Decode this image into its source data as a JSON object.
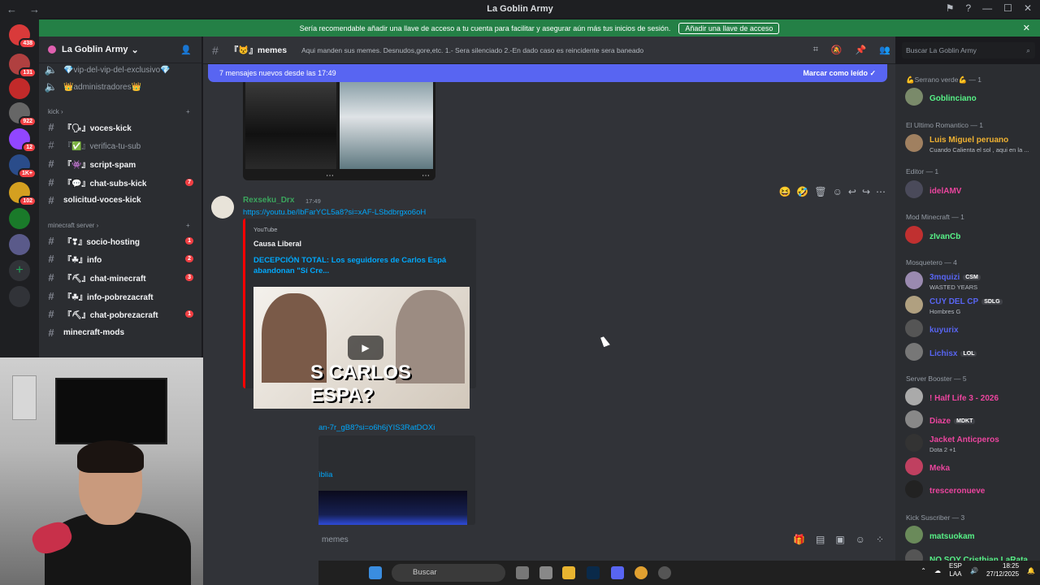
{
  "window": {
    "title": "La Goblin Army"
  },
  "banner": {
    "text": "Sería recomendable añadir una llave de acceso a tu cuenta para facilitar y asegurar aún más tus inicios de sesión.",
    "button": "Añadir una llave de acceso"
  },
  "servers": [
    {
      "badge": "438",
      "color": "#d93a3a"
    },
    {
      "badge": "131",
      "color": "#b04040"
    },
    {
      "badge": "",
      "color": "#c22a2a"
    },
    {
      "badge": "922",
      "color": "#666666"
    },
    {
      "badge": "12",
      "color": "#9146ff"
    },
    {
      "badge": "1K+",
      "color": "#2a4c8a"
    },
    {
      "badge": "102",
      "color": "#d4a020"
    },
    {
      "badge": "",
      "color": "#1a7a2a"
    },
    {
      "badge": "",
      "color": "#5a5a8a"
    }
  ],
  "guild": {
    "name": "La Goblin Army"
  },
  "channels_top": [
    {
      "label": "💎vip-del-vip-del-exclusivo💎"
    },
    {
      "label": "👑administradores👑"
    }
  ],
  "categories": {
    "kick": "kick",
    "minecraft": "minecraft server"
  },
  "channels_kick": [
    {
      "label": "『🗣』voces-kick",
      "badge": ""
    },
    {
      "label": "『✅』verifica-tu-sub",
      "badge": ""
    },
    {
      "label": "『👾』script-spam",
      "badge": ""
    },
    {
      "label": "『💬』chat-subs-kick",
      "badge": "7"
    },
    {
      "label": "solicitud-voces-kick",
      "badge": ""
    }
  ],
  "channels_mc": [
    {
      "label": "『❣』socio-hosting",
      "badge": "1"
    },
    {
      "label": "『☘』info",
      "badge": "2"
    },
    {
      "label": "『⛏』chat-minecraft",
      "badge": "3"
    },
    {
      "label": "『☘』info-pobrezacraft",
      "badge": ""
    },
    {
      "label": "『⛏』chat-pobrezacraft",
      "badge": "1"
    },
    {
      "label": "minecraft-mods",
      "badge": ""
    }
  ],
  "chat": {
    "channel": "『😾』memes",
    "topic": "Aqui manden sus memes. Desnudos,gore,etc. 1.- Sera silenciado 2.-En dado caso es reincidente sera baneado",
    "new_messages": "7 mensajes nuevos desde las 17:49",
    "mark_read": "Marcar como leído",
    "message": {
      "author": "Rexseku_Drx",
      "time": "17:49",
      "link": "https://youtu.be/IbFarYCL5a8?si=xAF-LSbdbrgxo6oH",
      "embed_provider": "YouTube",
      "embed_author": "Causa Liberal",
      "embed_title": "DECEPCIÓN TOTAL: Los seguidores de Carlos Espá abandonan \"Sí Cre...",
      "thumb_text": "S CARLOS ESPA?"
    },
    "message2_link": "an-7r_gB8?si=o6h6jYIS3RatDOXi",
    "message2_embed": "ìblia",
    "composer_placeholder": "memes"
  },
  "search": {
    "placeholder": "Buscar La Goblin Army"
  },
  "members": {
    "roles": [
      {
        "label": "💪Serrano verde💪 — 1"
      },
      {
        "label": "El Ultimo Romantico — 1"
      },
      {
        "label": "Editor — 1"
      },
      {
        "label": "Mod Minecraft — 1"
      },
      {
        "label": "Mosquetero — 4"
      },
      {
        "label": "Server Booster — 5"
      },
      {
        "label": "Kick Suscriber — 3"
      }
    ],
    "list": [
      {
        "name": "Goblinciano",
        "status": "",
        "tag": "",
        "color": "#57f287"
      },
      {
        "name": "Luis Miguel peruano",
        "status": "Cuando Calienta el sol , aqui en la ...",
        "tag": "",
        "color": "#f0b232"
      },
      {
        "name": "idelAMV",
        "status": "",
        "tag": "",
        "color": "#eb459e"
      },
      {
        "name": "zIvanCb",
        "status": "",
        "tag": "",
        "color": "#57f287"
      },
      {
        "name": "3mquizi",
        "status": "WASTED YEARS",
        "tag": "CSM",
        "color": "#5865f2"
      },
      {
        "name": "CUY DEL CP",
        "status": "Hombres G",
        "tag": "SDLG",
        "color": "#5865f2"
      },
      {
        "name": "kuyurix",
        "status": "",
        "tag": "",
        "color": "#5865f2"
      },
      {
        "name": "Lichisx",
        "status": "",
        "tag": "LOL",
        "color": "#5865f2"
      },
      {
        "name": "! Half Life 3 - 2026",
        "status": "",
        "tag": "",
        "color": "#eb459e"
      },
      {
        "name": "Diaze",
        "status": "",
        "tag": "MDKT",
        "color": "#eb459e"
      },
      {
        "name": "Jacket Anticperos",
        "status": "Dota 2 +1",
        "tag": "",
        "color": "#eb459e"
      },
      {
        "name": "Meka",
        "status": "",
        "tag": "",
        "color": "#eb459e"
      },
      {
        "name": "tresceronueve",
        "status": "",
        "tag": "",
        "color": "#eb459e"
      },
      {
        "name": "matsuokam",
        "status": "",
        "tag": "",
        "color": "#57f287"
      },
      {
        "name": "NO SOY Cristhian LaRata",
        "status": "",
        "tag": "",
        "color": "#57f287"
      }
    ]
  },
  "taskbar": {
    "search": "Buscar",
    "lang1": "ESP",
    "lang2": "LAA",
    "time": "18:25",
    "date": "27/12/2025"
  }
}
